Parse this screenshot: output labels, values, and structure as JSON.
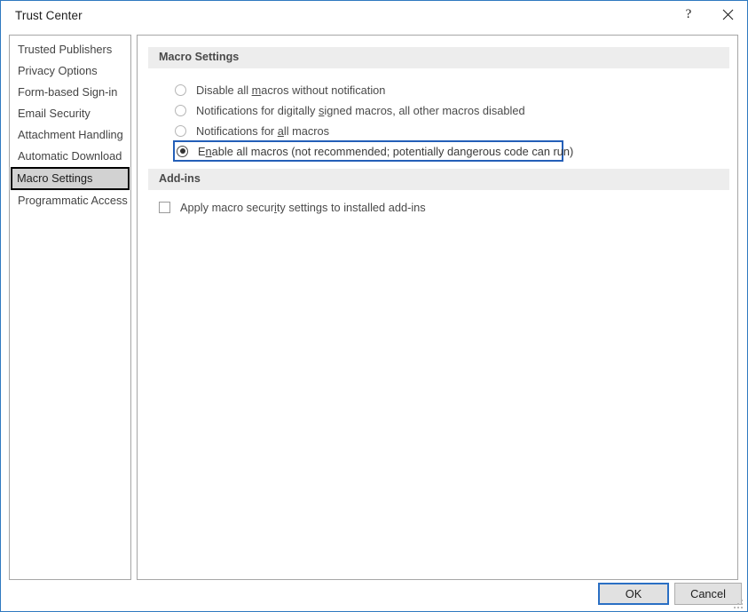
{
  "window": {
    "title": "Trust Center",
    "help_icon": "question-mark-icon",
    "close_icon": "close-icon",
    "border_color": "#2f79c0"
  },
  "sidebar": {
    "items": [
      {
        "label": "Trusted Publishers",
        "selected": false
      },
      {
        "label": "Privacy Options",
        "selected": false
      },
      {
        "label": "Form-based Sign-in",
        "selected": false
      },
      {
        "label": "Email Security",
        "selected": false
      },
      {
        "label": "Attachment Handling",
        "selected": false
      },
      {
        "label": "Automatic Download",
        "selected": false
      },
      {
        "label": "Macro Settings",
        "selected": true
      },
      {
        "label": "Programmatic Access",
        "selected": false
      }
    ],
    "selected_bg": "#d2d2d2"
  },
  "main": {
    "sections": [
      {
        "id": "macro",
        "title": "Macro Settings"
      },
      {
        "id": "addins",
        "title": "Add-ins"
      }
    ],
    "macro_options": [
      {
        "pre": "Disable all ",
        "accel": "m",
        "post": "acros without notification",
        "selected": false,
        "focused": false
      },
      {
        "pre": "Notifications for digitally ",
        "accel": "s",
        "post": "igned macros, all other macros disabled",
        "selected": false,
        "focused": false
      },
      {
        "pre": "Notifications for ",
        "accel": "a",
        "post": "ll macros",
        "selected": false,
        "focused": false
      },
      {
        "pre": "E",
        "accel": "n",
        "post": "able all macros (not recommended; potentially dangerous code can run)",
        "selected": true,
        "focused": true
      }
    ],
    "addins_option": {
      "pre": "Apply macro secur",
      "accel": "i",
      "post": "ty settings to installed add-ins",
      "checked": false
    },
    "header_bg": "#ededed"
  },
  "footer": {
    "ok_label": "OK",
    "cancel_label": "Cancel",
    "focus_color": "#2a6fc4"
  }
}
